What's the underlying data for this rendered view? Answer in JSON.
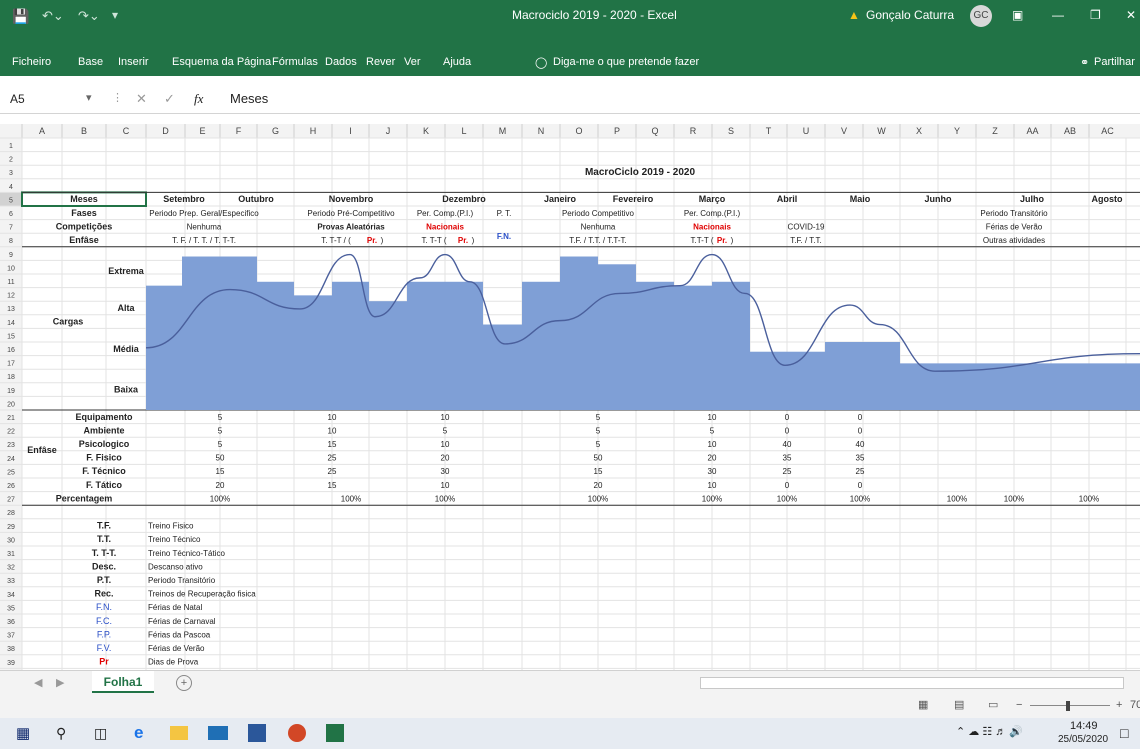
{
  "window": {
    "title": "Macrociclo 2019 - 2020  -  Excel",
    "user": "Gonçalo Caturra",
    "user_initials": "GC",
    "share": "Partilhar"
  },
  "ribbon": {
    "tabs": [
      "Ficheiro",
      "Base",
      "Inserir",
      "Esquema da Página",
      "Fórmulas",
      "Dados",
      "Rever",
      "Ver",
      "Ajuda"
    ],
    "tell_me": "Diga-me o que pretende fazer"
  },
  "formula_bar": {
    "name_box": "A5",
    "fx": "fx",
    "content": "Meses"
  },
  "columns": [
    "A",
    "B",
    "C",
    "D",
    "E",
    "F",
    "G",
    "H",
    "I",
    "J",
    "K",
    "L",
    "M",
    "N",
    "O",
    "P",
    "Q",
    "R",
    "S",
    "T",
    "U",
    "V",
    "W",
    "X",
    "Y",
    "Z",
    "AA",
    "AB",
    "AC"
  ],
  "rows": [
    "1",
    "2",
    "3",
    "4",
    "5",
    "6",
    "7",
    "8",
    "9",
    "10",
    "11",
    "12",
    "13",
    "14",
    "15",
    "16",
    "17",
    "18",
    "19",
    "20",
    "21",
    "22",
    "23",
    "24",
    "25",
    "26",
    "27",
    "28",
    "29",
    "30",
    "31",
    "32",
    "33",
    "34",
    "35",
    "36",
    "37",
    "38",
    "39",
    "40"
  ],
  "sheet": {
    "title": "MacroCiclo 2019 - 2020",
    "labels": {
      "meses": "Meses",
      "fases": "Fases",
      "competicoes": "Competições",
      "enfase": "Enfâse",
      "cargas": "Cargas",
      "extrema": "Extrema",
      "alta": "Alta",
      "media": "Média",
      "baixa": "Baixa",
      "enfase2": "Enfâse",
      "percentagem": "Percentagem"
    },
    "months": [
      "Setembro",
      "Outubro",
      "Novembro",
      "Dezembro",
      "Janeiro",
      "Fevereiro",
      "Março",
      "Abril",
      "Maio",
      "Junho",
      "Julho",
      "Agosto"
    ],
    "fases": [
      "Periodo Prep. Geral/Especifico",
      "Periodo Pré-Competitivo",
      "Per. Comp.(P.I.)",
      "P. T.",
      "Periodo Competitivo",
      "Per. Comp.(P.I.)",
      "COVID-19",
      "Periodo Transitório"
    ],
    "competicoes": [
      "Nenhuma",
      "Provas Aleatórias",
      "Nacionais",
      "Nenhuma",
      "Nacionais",
      "Férias de Verão"
    ],
    "fn": "F.N.",
    "enfase_row": {
      "a": "T. F. / T. T. / T. T-T.",
      "b": "T. T-T / (",
      "c": "Pr.",
      "d": ")",
      "e": "T. T-T (",
      "f": "T.F. / T.T. / T.T-T.",
      "g": "T.T-T (",
      "h": "T.F. / T.T.",
      "i": "Outras atividades"
    },
    "enfase_items": [
      "Equipamento",
      "Ambiente",
      "Psicologico",
      "F. Fisico",
      "F. Técnico",
      "F. Tático"
    ],
    "enfase_values": [
      [
        "5",
        "10",
        "10",
        "5",
        "10",
        "0",
        "0"
      ],
      [
        "5",
        "10",
        "5",
        "5",
        "5",
        "0",
        "0"
      ],
      [
        "5",
        "15",
        "10",
        "5",
        "10",
        "40",
        "40"
      ],
      [
        "50",
        "25",
        "20",
        "50",
        "20",
        "35",
        "35"
      ],
      [
        "15",
        "25",
        "30",
        "15",
        "30",
        "25",
        "25"
      ],
      [
        "20",
        "15",
        "10",
        "20",
        "10",
        "0",
        "0"
      ]
    ],
    "percent": [
      "100%",
      "100%",
      "100%",
      "100%",
      "100%",
      "100%",
      "100%",
      "100%",
      "100%",
      "100%"
    ],
    "legend": [
      {
        "abbr": "T.F.",
        "desc": "Treino Fisico",
        "c": ""
      },
      {
        "abbr": "T.T.",
        "desc": "Treino Técnico",
        "c": ""
      },
      {
        "abbr": "T. T-T.",
        "desc": "Treino Técnico-Tático",
        "c": ""
      },
      {
        "abbr": "Desc.",
        "desc": "Descanso ativo",
        "c": ""
      },
      {
        "abbr": "P.T.",
        "desc": "Periodo Transitório",
        "c": ""
      },
      {
        "abbr": "Rec.",
        "desc": "Treinos de Recuperação fisica",
        "c": ""
      },
      {
        "abbr": "F.N.",
        "desc": "Férias de Natal",
        "c": "blue"
      },
      {
        "abbr": "F.C.",
        "desc": "Férias de Carnaval",
        "c": "blue"
      },
      {
        "abbr": "F.P.",
        "desc": "Férias da Pascoa",
        "c": "blue"
      },
      {
        "abbr": "F.V.",
        "desc": "Férias de Verão",
        "c": "blue"
      },
      {
        "abbr": "Pr",
        "desc": "Dias de Prova",
        "c": "red"
      }
    ]
  },
  "chart_data": {
    "type": "area",
    "categories": [
      "Setembro",
      "Outubro",
      "Novembro",
      "Dezembro",
      "Janeiro",
      "Fevereiro",
      "Março",
      "Abril",
      "Maio",
      "Junho",
      "Julho",
      "Agosto"
    ],
    "y_levels": [
      "Baixa",
      "Média",
      "Alta",
      "Extrema"
    ]
  },
  "tabs": {
    "sheet": "Folha1",
    "add": "+"
  },
  "status": {
    "zoom": "70"
  },
  "clock": {
    "time": "14:49",
    "date": "25/05/2020"
  },
  "colors": {
    "accent": "#217346",
    "fill": "#7f9fd6",
    "line": "#4a5f9c",
    "red": "#e00000",
    "blue": "#2a4fc7"
  }
}
